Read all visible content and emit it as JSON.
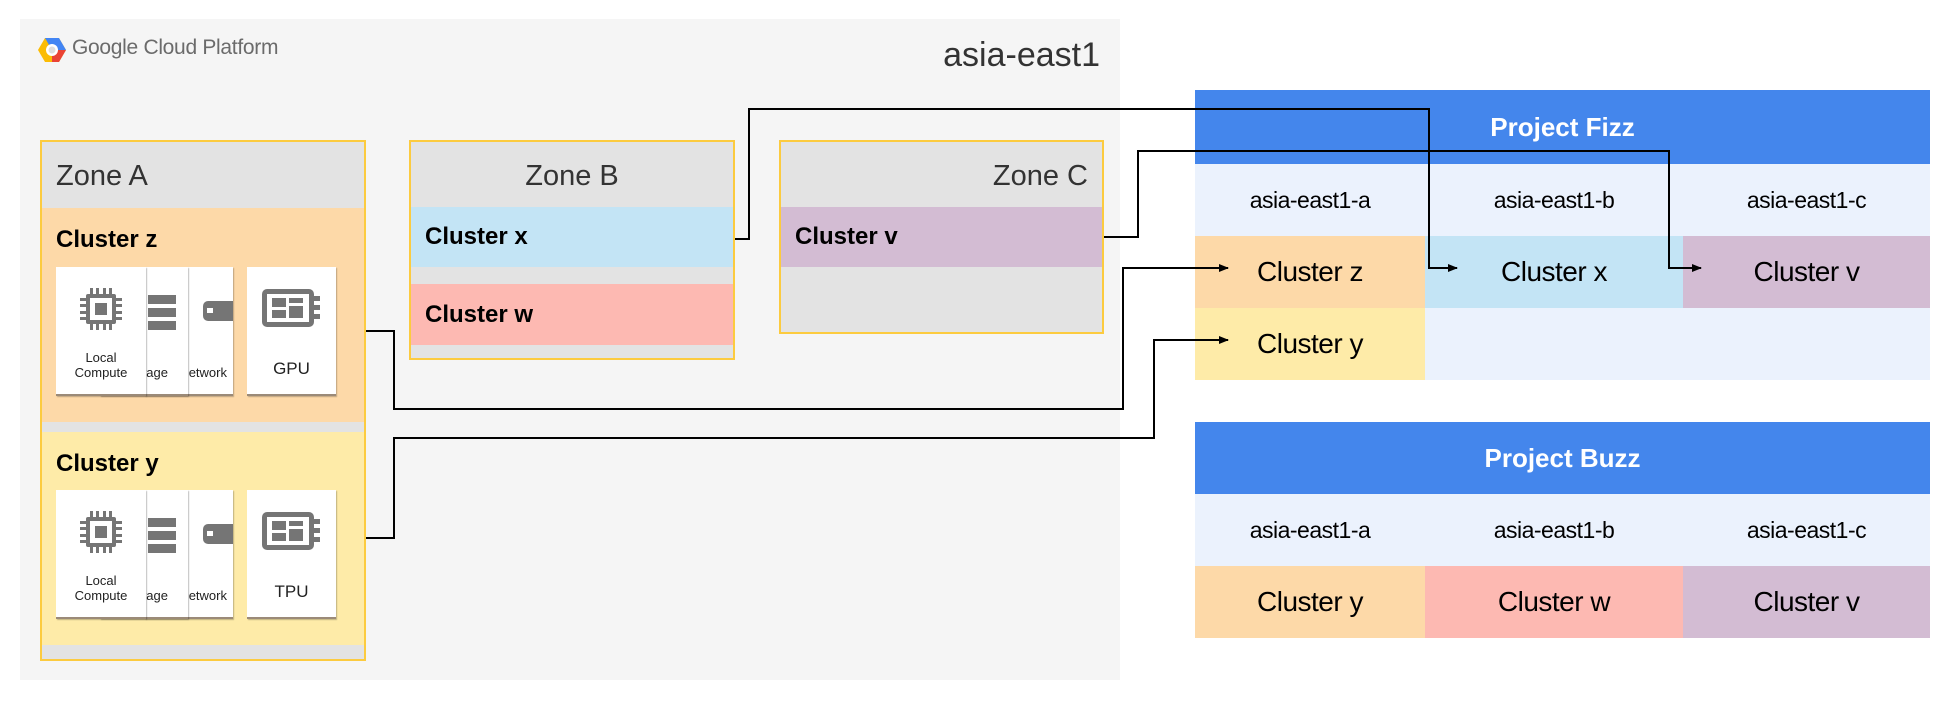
{
  "brand": {
    "name": "Google Cloud Platform",
    "logo": "gcp-hexagon-logo"
  },
  "region": "asia-east1",
  "colors": {
    "orange": "#fdd9a8",
    "yellow": "#feeba8",
    "blue": "#c3e4f5",
    "pink": "#fdb9b2",
    "purple": "#d3bcd3",
    "project_header": "#4486ec",
    "zone_row": "#ebf2fd",
    "zone_border": "#fccb3f"
  },
  "zones": [
    {
      "name": "Zone A",
      "clusters": [
        {
          "name": "Cluster z",
          "cards": [
            "Local Compute",
            "Storage",
            "Network",
            "GPU"
          ]
        },
        {
          "name": "Cluster y",
          "cards": [
            "Local Compute",
            "Storage",
            "Network",
            "TPU"
          ]
        }
      ]
    },
    {
      "name": "Zone B",
      "clusters": [
        {
          "name": "Cluster x"
        },
        {
          "name": "Cluster w"
        }
      ]
    },
    {
      "name": "Zone C",
      "clusters": [
        {
          "name": "Cluster v"
        }
      ]
    }
  ],
  "projects": [
    {
      "title": "Project Fizz",
      "zones": [
        "asia-east1-a",
        "asia-east1-b",
        "asia-east1-c"
      ],
      "rows": [
        [
          "Cluster z",
          "Cluster x",
          "Cluster v"
        ],
        [
          "Cluster y",
          "",
          ""
        ]
      ]
    },
    {
      "title": "Project Buzz",
      "zones": [
        "asia-east1-a",
        "asia-east1-b",
        "asia-east1-c"
      ],
      "rows": [
        [
          "Cluster y",
          "Cluster w",
          "Cluster v"
        ]
      ]
    }
  ],
  "connections": [
    [
      "Cluster x",
      "Project Fizz / Cluster x"
    ],
    [
      "Cluster v",
      "Project Fizz / Cluster v"
    ],
    [
      "Cluster z",
      "Project Fizz / Cluster z"
    ],
    [
      "Cluster y",
      "Project Fizz / Cluster y"
    ]
  ]
}
